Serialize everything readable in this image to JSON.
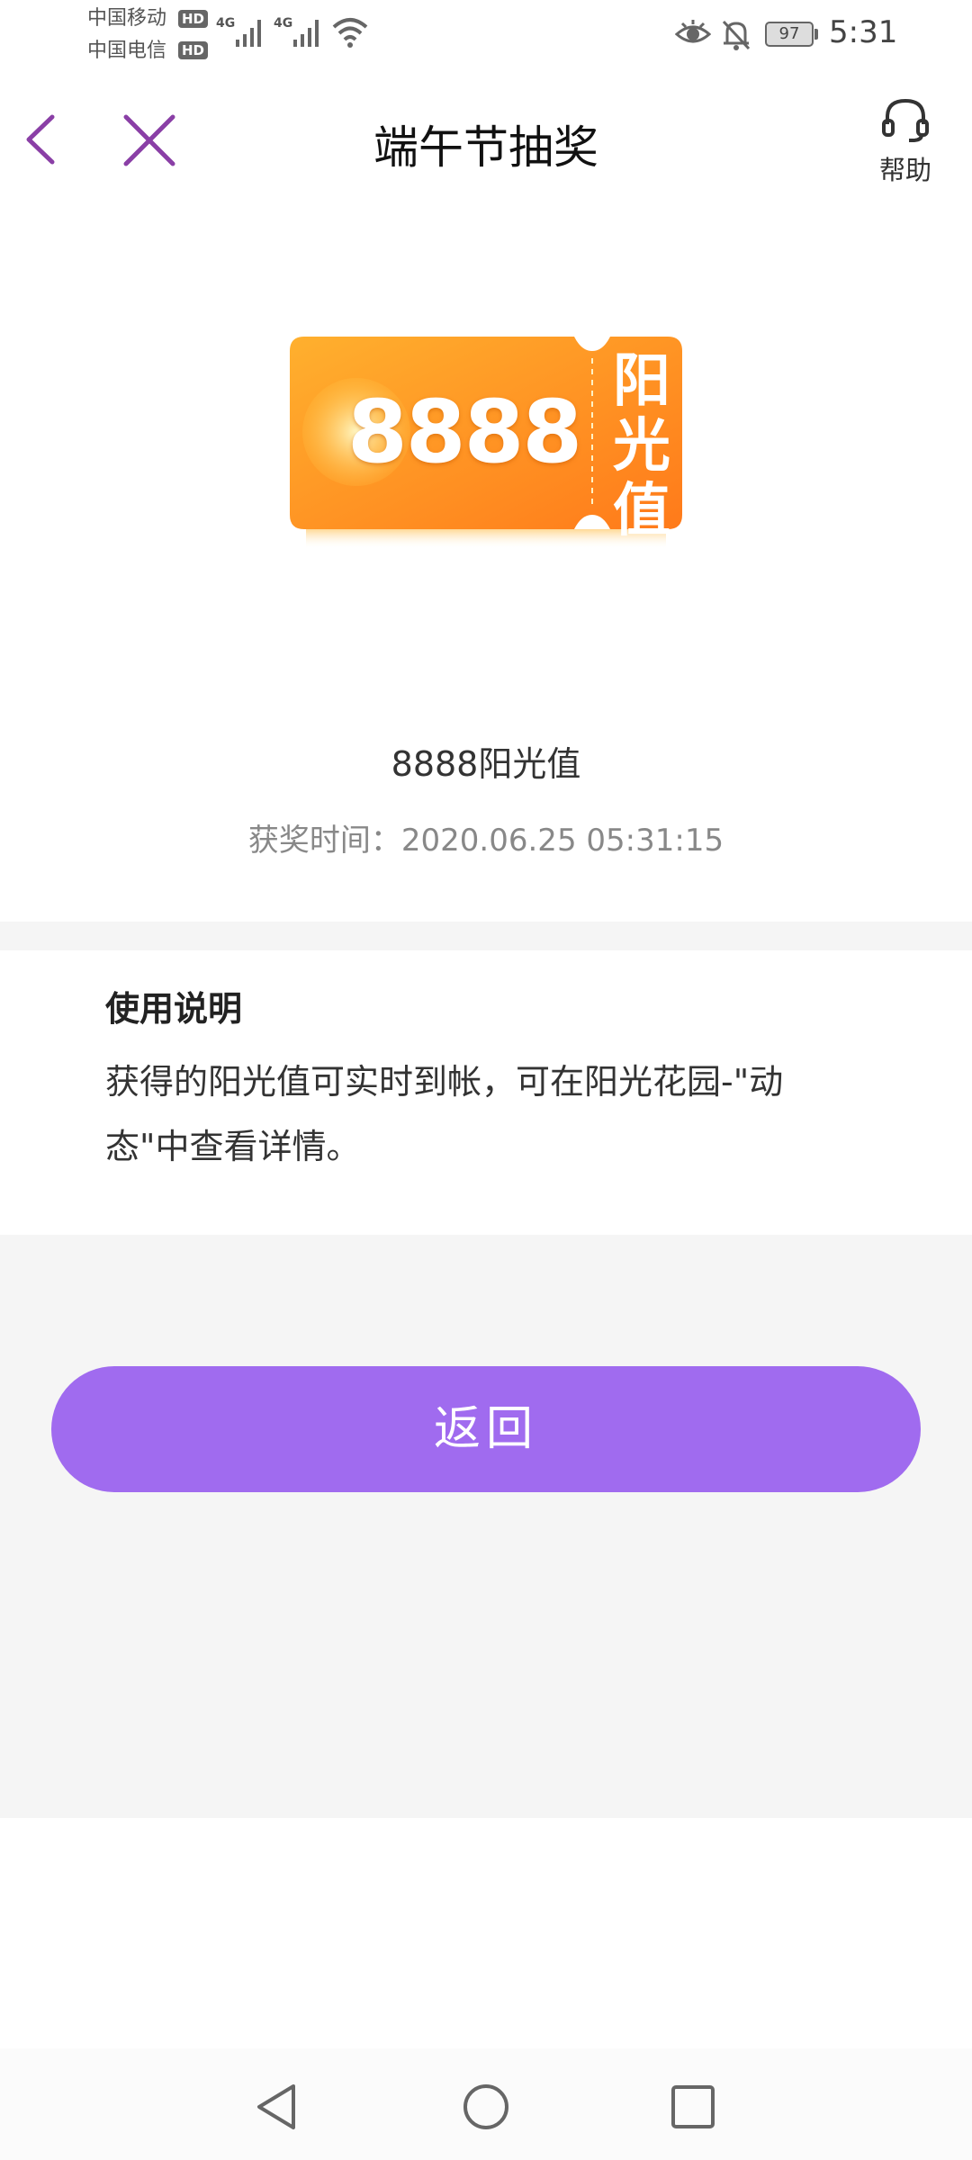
{
  "status_bar": {
    "carrier_1": "中国移动",
    "carrier_2": "中国电信",
    "hd_1": "HD",
    "hd_2": "HD",
    "network_1": "4G",
    "network_2": "4G",
    "battery": "97",
    "time": "5:31"
  },
  "header": {
    "title": "端午节抽奖",
    "help_label": "帮助"
  },
  "ticket": {
    "amount": "8888",
    "unit": "阳光值"
  },
  "prize": {
    "name": "8888阳光值",
    "time": "获奖时间：2020.06.25 05:31:15"
  },
  "usage": {
    "title": "使用说明",
    "body": "获得的阳光值可实时到帐，可在阳光花园-\"动态\"中查看详情。"
  },
  "actions": {
    "return_label": "返回"
  },
  "colors": {
    "accent": "#a06bef",
    "icon_purple": "#8a3fa6",
    "ticket_orange": "#ff8f1f"
  }
}
